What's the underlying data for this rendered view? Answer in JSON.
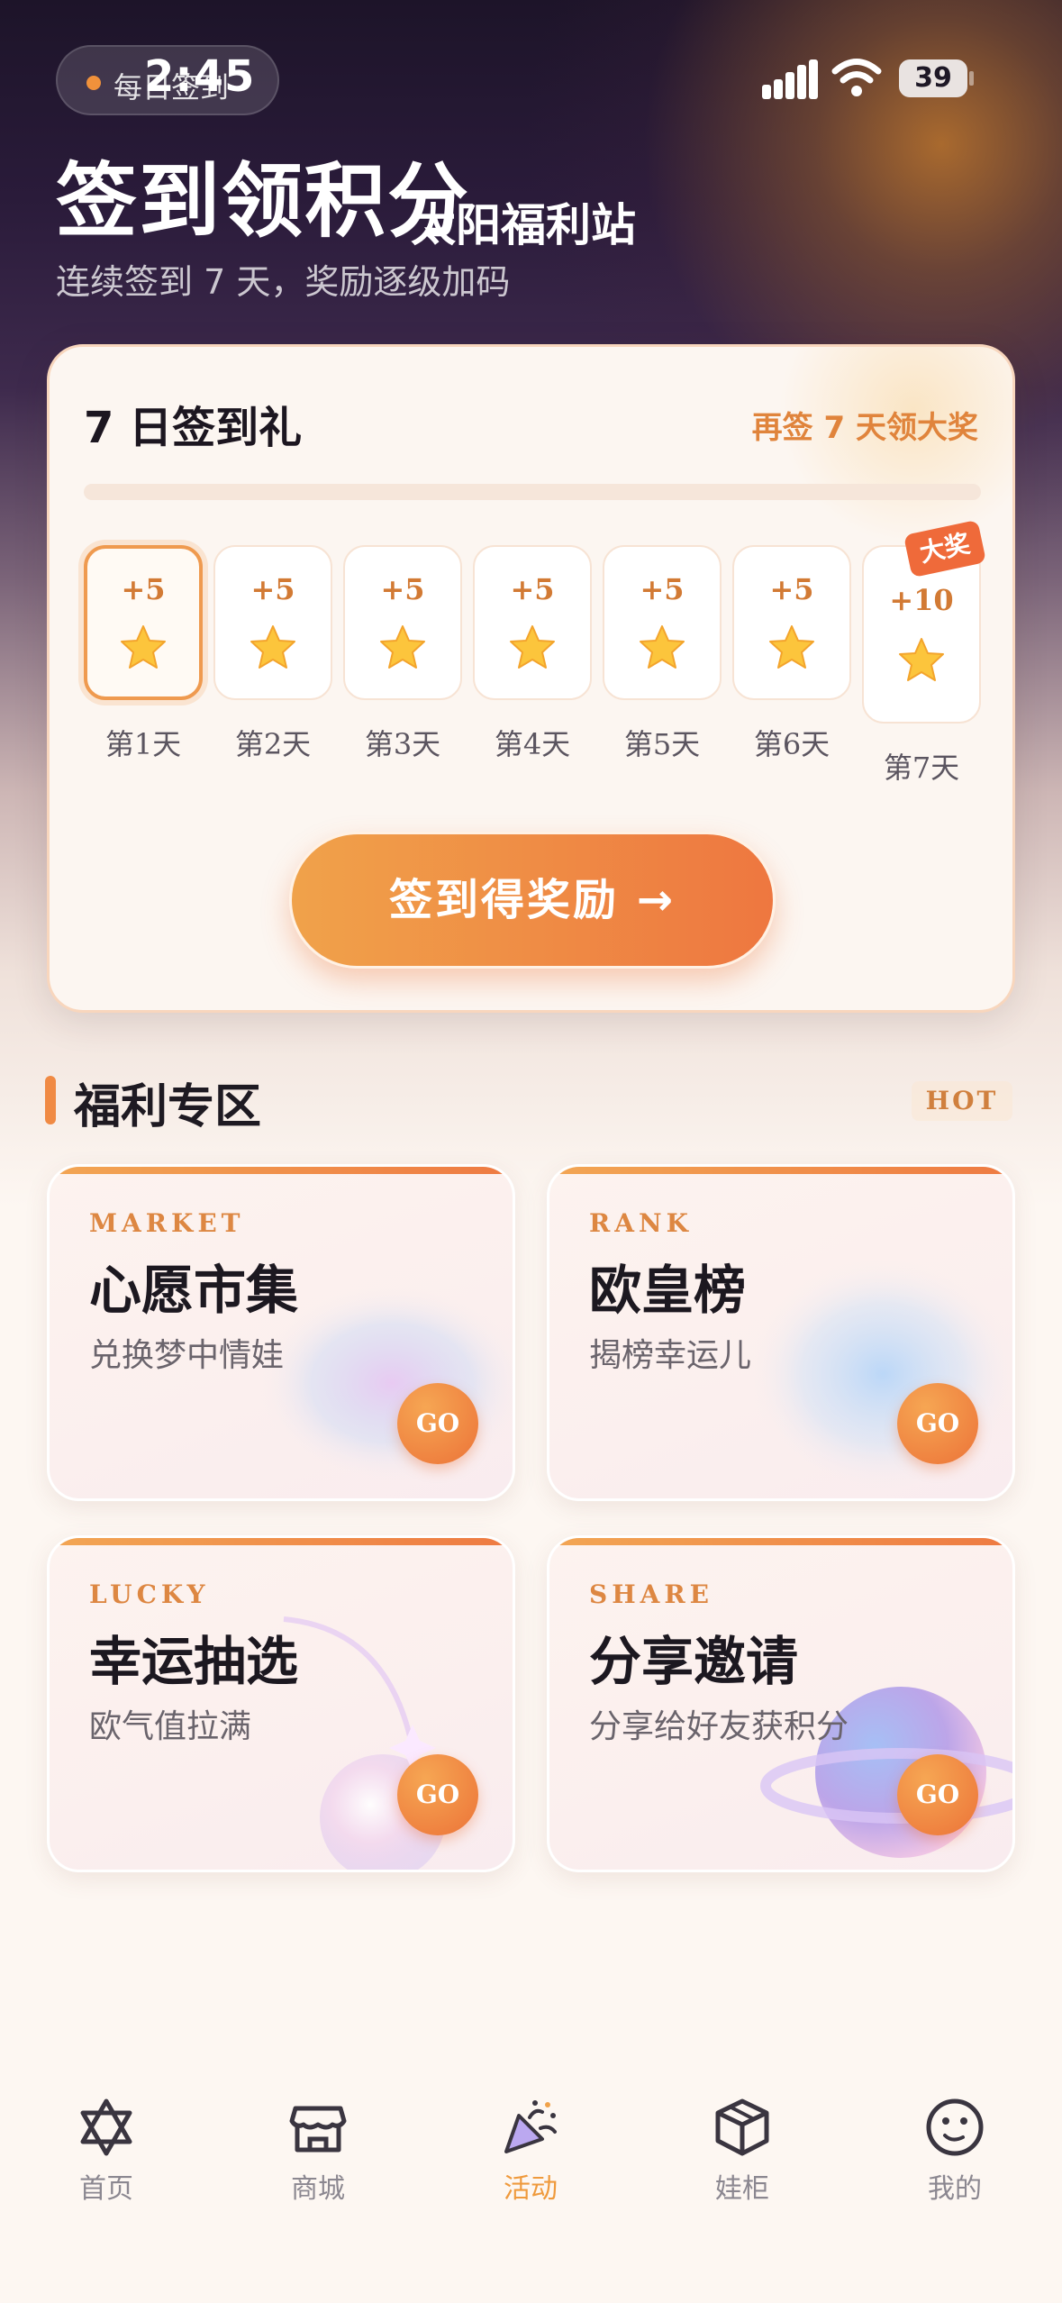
{
  "status_bar": {
    "pill_text": "每日签到",
    "time": "2:45",
    "battery": "39"
  },
  "header": {
    "title": "签到领积分",
    "site_name": "太阳福利站",
    "subtitle": "连续签到 7 天，奖励逐级加码"
  },
  "checkin": {
    "title": "7 日签到礼",
    "hint": "再签 7 天领大奖",
    "progress": 0,
    "big_badge": "大奖",
    "days": [
      {
        "points": "+5",
        "label": "第1天",
        "icon": "star-icon"
      },
      {
        "points": "+5",
        "label": "第2天",
        "icon": "star-icon"
      },
      {
        "points": "+5",
        "label": "第3天",
        "icon": "star-icon"
      },
      {
        "points": "+5",
        "label": "第4天",
        "icon": "star-icon"
      },
      {
        "points": "+5",
        "label": "第5天",
        "icon": "star-icon"
      },
      {
        "points": "+5",
        "label": "第6天",
        "icon": "star-icon"
      },
      {
        "points": "+10",
        "label": "第7天",
        "icon": "star-icon"
      }
    ],
    "button_label": "签到得奖励 →"
  },
  "welfare": {
    "title": "福利专区",
    "tag": "HOT",
    "cards": [
      {
        "en": "MARKET",
        "title": "心愿市集",
        "desc": "兑换梦中情娃",
        "go": "GO"
      },
      {
        "en": "RANK",
        "title": "欧皇榜",
        "desc": "揭榜幸运儿",
        "go": "GO"
      },
      {
        "en": "LUCKY",
        "title": "幸运抽选",
        "desc": "欧气值拉满",
        "go": "GO"
      },
      {
        "en": "SHARE",
        "title": "分享邀请",
        "desc": "分享给好友获积分",
        "go": "GO"
      }
    ]
  },
  "tabbar": {
    "active": "活动",
    "active_color": "#ef9a3d",
    "items": [
      {
        "label": "首页",
        "icon": "star-of-david-icon"
      },
      {
        "label": "商城",
        "icon": "store-icon"
      },
      {
        "label": "活动",
        "icon": "party-popper-icon"
      },
      {
        "label": "娃柜",
        "icon": "box-icon"
      },
      {
        "label": "我的",
        "icon": "smiley-face-icon"
      }
    ]
  },
  "colors": {
    "accent": "#ef8a44",
    "accent_light": "#f0a24a",
    "text_dark": "#1c1820"
  }
}
